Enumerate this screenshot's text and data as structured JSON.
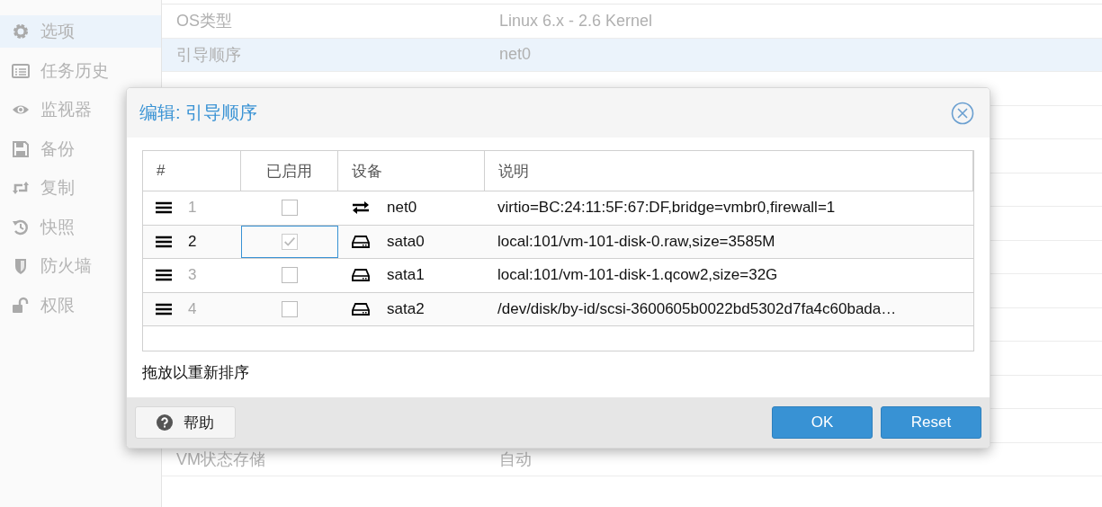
{
  "sidebar": {
    "items": [
      {
        "label": "选项",
        "selected": true
      },
      {
        "label": "任务历史",
        "selected": false
      },
      {
        "label": "监视器",
        "selected": false
      },
      {
        "label": "备份",
        "selected": false
      },
      {
        "label": "复制",
        "selected": false
      },
      {
        "label": "快照",
        "selected": false
      },
      {
        "label": "防火墙",
        "selected": false
      },
      {
        "label": "权限",
        "selected": false
      }
    ]
  },
  "options": {
    "rows": [
      {
        "name": "OS类型",
        "value": "Linux 6.x - 2.6 Kernel",
        "selected": false
      },
      {
        "name": "引导顺序",
        "value": "net0",
        "selected": true
      },
      {
        "name": "VM状态存储",
        "value": "自动",
        "selected": false
      }
    ]
  },
  "dialog": {
    "title": "编辑: 引导顺序",
    "table": {
      "columns": [
        "#",
        "已启用",
        "设备",
        "说明"
      ],
      "rows": [
        {
          "order": "1",
          "enabled": false,
          "selected": false,
          "kind": "net",
          "device": "net0",
          "description": "virtio=BC:24:11:5F:67:DF,bridge=vmbr0,firewall=1"
        },
        {
          "order": "2",
          "enabled": true,
          "selected": true,
          "kind": "disk",
          "device": "sata0",
          "description": "local:101/vm-101-disk-0.raw,size=3585M"
        },
        {
          "order": "3",
          "enabled": false,
          "selected": false,
          "kind": "disk",
          "device": "sata1",
          "description": "local:101/vm-101-disk-1.qcow2,size=32G"
        },
        {
          "order": "4",
          "enabled": false,
          "selected": false,
          "kind": "disk",
          "device": "sata2",
          "description": "/dev/disk/by-id/scsi-3600605b0022bd5302d7fa4c60bada…"
        }
      ]
    },
    "hint": "拖放以重新排序",
    "buttons": {
      "help": "帮助",
      "ok": "OK",
      "reset": "Reset"
    }
  }
}
